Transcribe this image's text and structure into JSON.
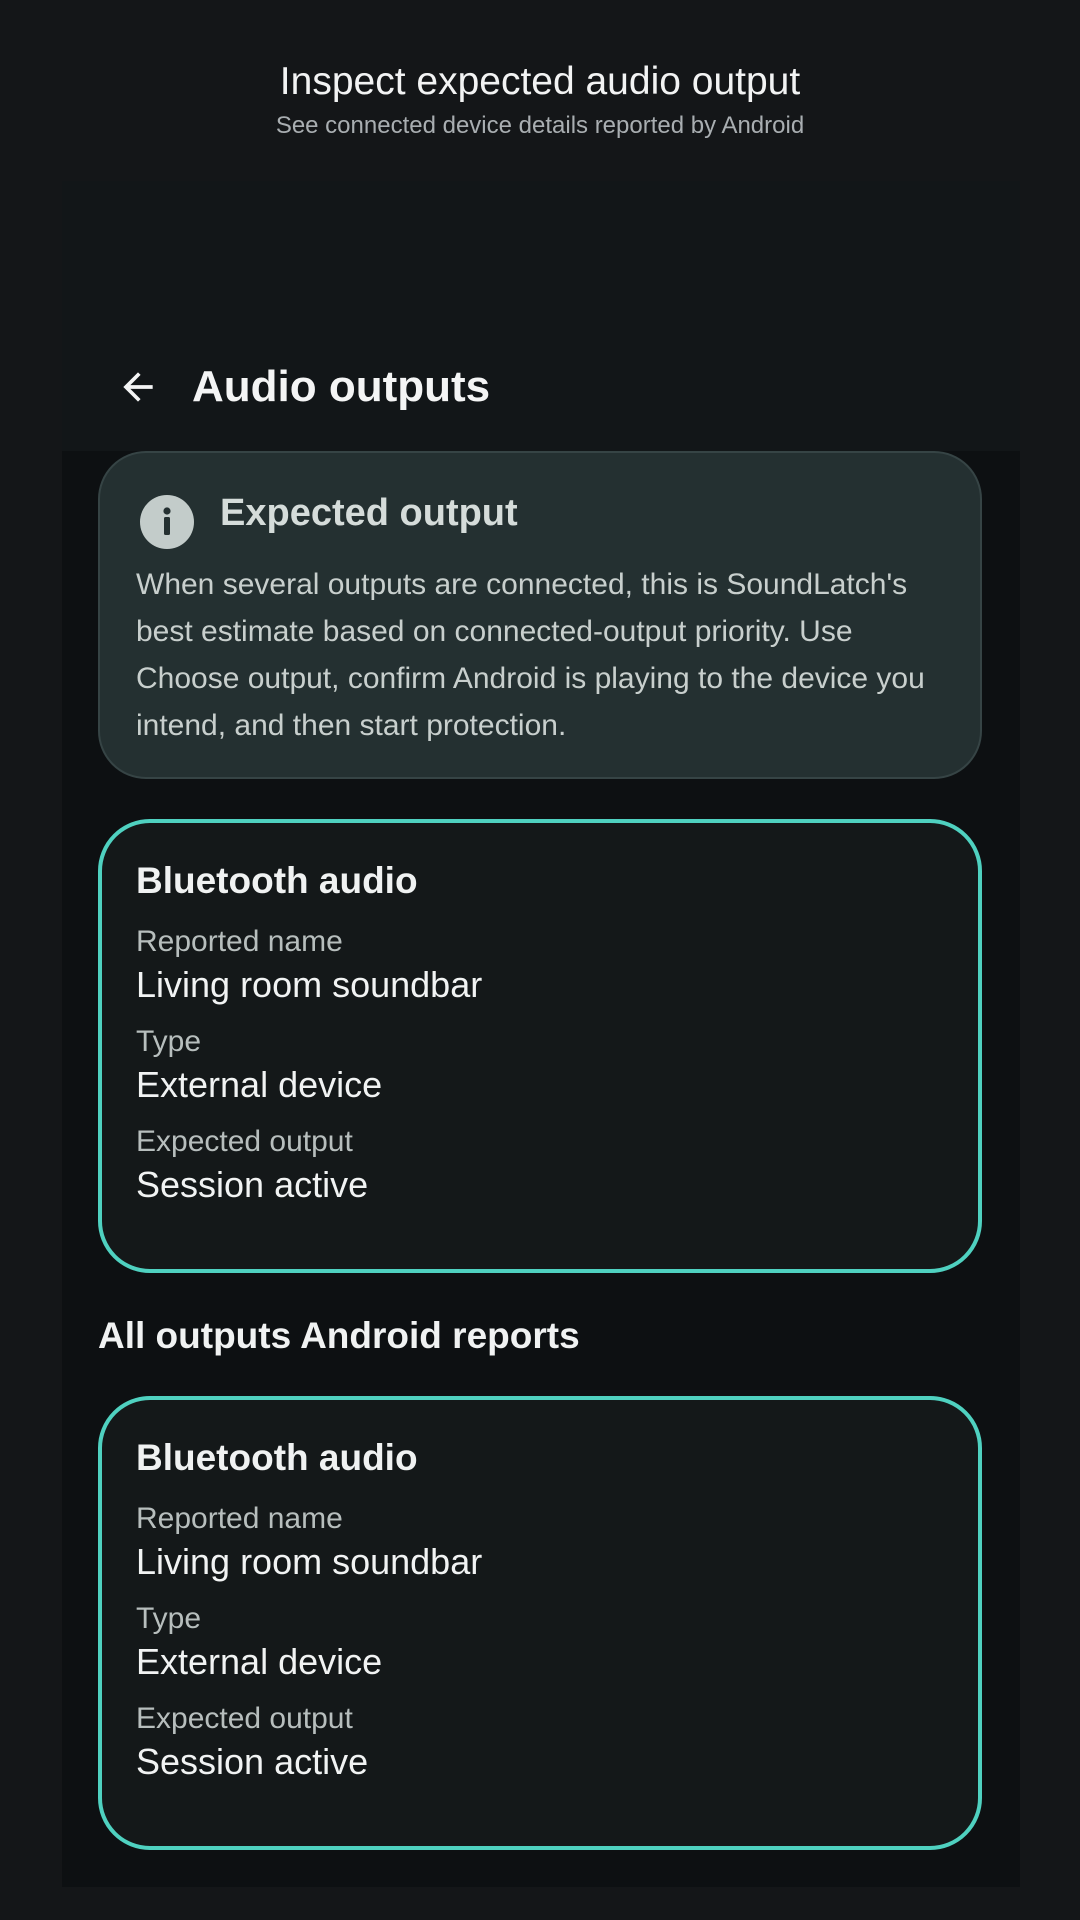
{
  "caption": {
    "title": "Inspect expected audio output",
    "subtitle": "See connected device details reported by Android"
  },
  "appbar": {
    "title": "Audio outputs",
    "back_icon": "arrow-left-icon"
  },
  "info_card": {
    "icon": "info-icon",
    "title": "Expected output",
    "body": "When several outputs are connected, this is SoundLatch's best estimate based on connected-output priority. Use Choose output, confirm Android is playing to the device you intend, and then start protection."
  },
  "expected_device": {
    "title": "Bluetooth audio",
    "name_label": "Reported name",
    "name_value": "Living room soundbar",
    "type_label": "Type",
    "type_value": "External device",
    "output_label": "Expected output",
    "output_value": "Session active"
  },
  "all_outputs": {
    "heading": "All outputs Android reports",
    "items": [
      {
        "title": "Bluetooth audio",
        "name_label": "Reported name",
        "name_value": "Living room soundbar",
        "type_label": "Type",
        "type_value": "External device",
        "output_label": "Expected output",
        "output_value": "Session active"
      }
    ]
  },
  "colors": {
    "accent": "#4fd1c0",
    "background": "#141618",
    "surface": "#0d1012",
    "info_card": "#243031"
  }
}
